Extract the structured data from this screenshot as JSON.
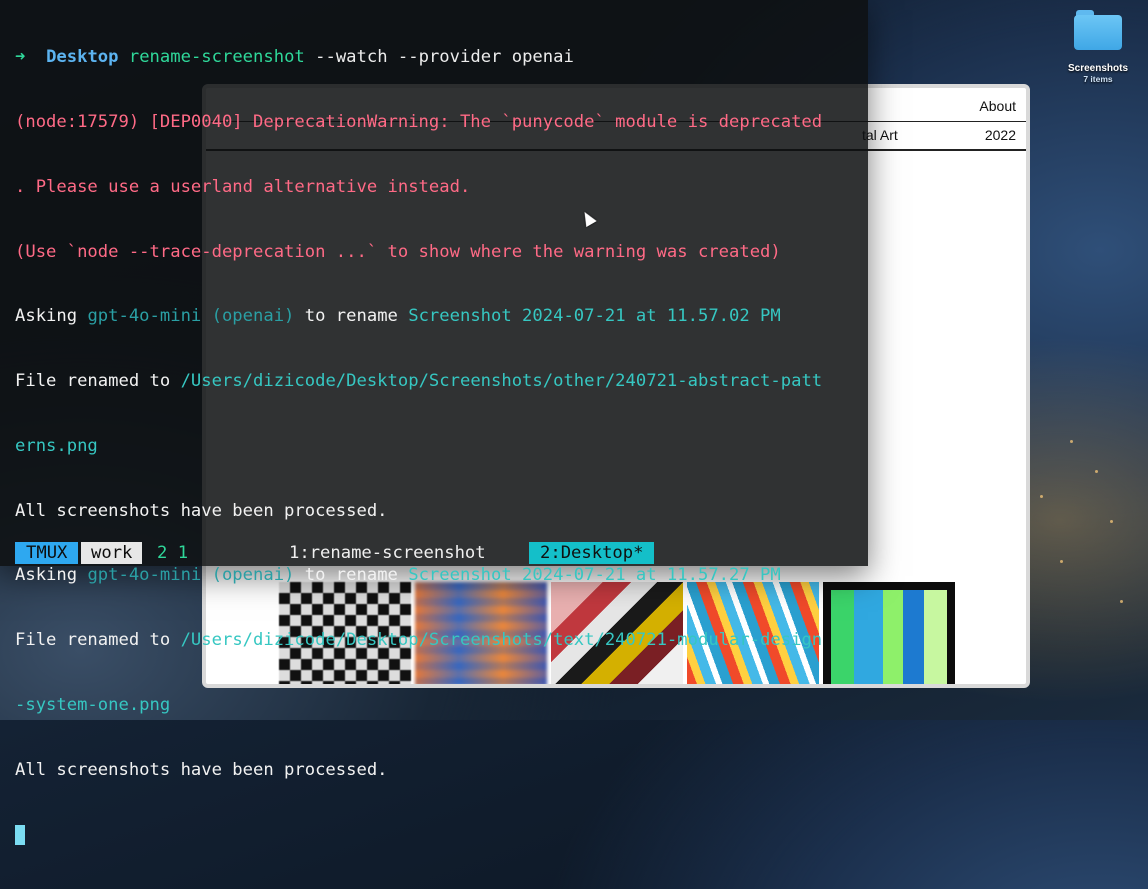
{
  "desktop": {
    "folder": {
      "name": "Screenshots",
      "meta": "7 items",
      "icon": "folder-icon"
    }
  },
  "browser": {
    "nav_about": "About",
    "row_left": "tal Art",
    "row_right": "2022"
  },
  "terminal": {
    "prompt_symbol": "➜",
    "cwd": "Desktop",
    "command": "rename-screenshot",
    "command_args": " --watch --provider openai",
    "warning_1": "(node:17579) [DEP0040] DeprecationWarning: The `punycode` module is deprecated",
    "warning_2": ". Please use a userland alternative instead.",
    "warning_3": "(Use `node --trace-deprecation ...` to show where the warning was created)",
    "asking_label": "Asking ",
    "model": "gpt-4o-mini (openai)",
    "to_rename": " to rename ",
    "shot_1": "Screenshot 2024-07-21 at 11.57.02 PM",
    "renamed_label": "File renamed to ",
    "path_1a": "/Users/dizicode/Desktop/Screenshots/other/240721-abstract-patt",
    "path_1b": "erns.png",
    "processed": "All screenshots have been processed.",
    "shot_2": "Screenshot 2024-07-21 at 11.57.27 PM",
    "path_2a": "/Users/dizicode/Desktop/Screenshots/text/240721-modular-design",
    "path_2b": "-system-one.png"
  },
  "statusbar": {
    "session_label": "TMUX",
    "session_name": "work",
    "pane_nums": "2 1",
    "window_1": "1:rename-screenshot",
    "window_2": "2:Desktop*"
  },
  "colors": {
    "tmux_blue": "#2ea8f0",
    "active_window": "#14bfc9",
    "error_pink": "#ff6a86",
    "highlight_teal": "#36c7c2",
    "prompt_green": "#2fd89a"
  }
}
